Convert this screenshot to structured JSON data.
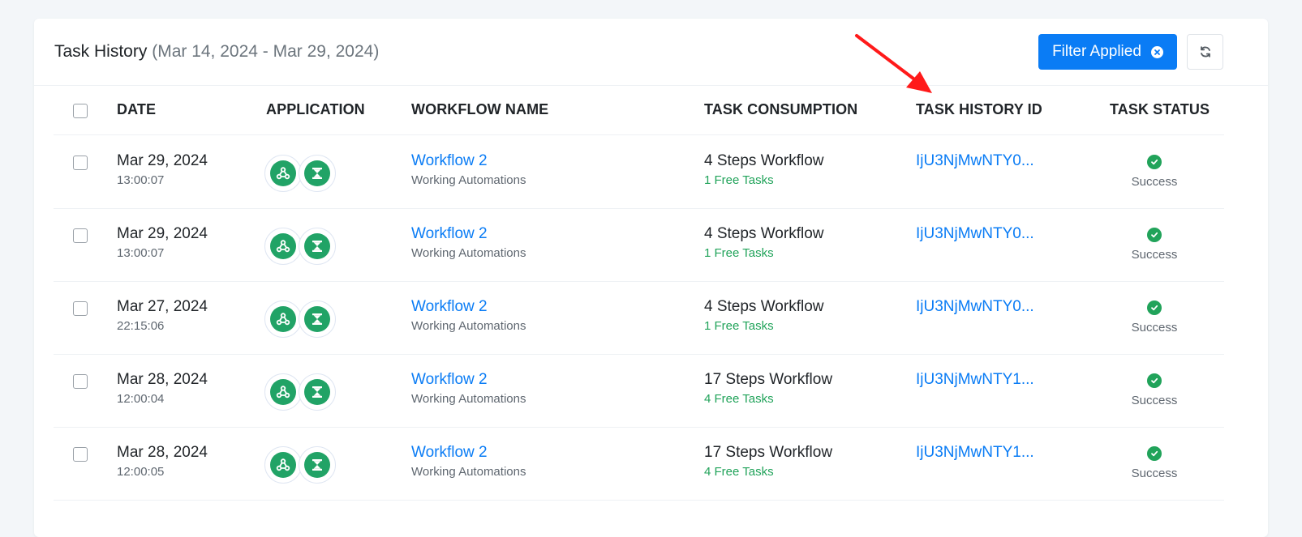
{
  "header": {
    "title": "Task History",
    "date_range": "(Mar 14, 2024 - Mar 29, 2024)",
    "filter_label": "Filter Applied",
    "refresh_icon": "refresh-icon"
  },
  "columns": {
    "date": "DATE",
    "application": "APPLICATION",
    "workflow_name": "WORKFLOW NAME",
    "task_consumption": "TASK CONSUMPTION",
    "task_history_id": "TASK HISTORY ID",
    "task_status": "TASK STATUS"
  },
  "rows": [
    {
      "date": "Mar 29, 2024",
      "time": "13:00:07",
      "workflow": "Workflow 2",
      "folder": "Working Automations",
      "steps": "4 Steps Workflow",
      "free": "1 Free Tasks",
      "history_id": "IjU3NjMwNTY0...",
      "status": "Success"
    },
    {
      "date": "Mar 29, 2024",
      "time": "13:00:07",
      "workflow": "Workflow 2",
      "folder": "Working Automations",
      "steps": "4 Steps Workflow",
      "free": "1 Free Tasks",
      "history_id": "IjU3NjMwNTY0...",
      "status": "Success"
    },
    {
      "date": "Mar 27, 2024",
      "time": "22:15:06",
      "workflow": "Workflow 2",
      "folder": "Working Automations",
      "steps": "4 Steps Workflow",
      "free": "1 Free Tasks",
      "history_id": "IjU3NjMwNTY0...",
      "status": "Success"
    },
    {
      "date": "Mar 28, 2024",
      "time": "12:00:04",
      "workflow": "Workflow 2",
      "folder": "Working Automations",
      "steps": "17 Steps Workflow",
      "free": "4 Free Tasks",
      "history_id": "IjU3NjMwNTY1...",
      "status": "Success"
    },
    {
      "date": "Mar 28, 2024",
      "time": "12:00:05",
      "workflow": "Workflow 2",
      "folder": "Working Automations",
      "steps": "17 Steps Workflow",
      "free": "4 Free Tasks",
      "history_id": "IjU3NjMwNTY1...",
      "status": "Success"
    }
  ],
  "colors": {
    "accent": "#0a7cf5",
    "success": "#21a35a",
    "app_icon": "#21a366",
    "annotation_arrow": "#ff1a1a"
  },
  "icons": [
    "webhook-icon",
    "schedule-icon",
    "check-circle-icon",
    "close-circle-icon",
    "refresh-icon"
  ]
}
